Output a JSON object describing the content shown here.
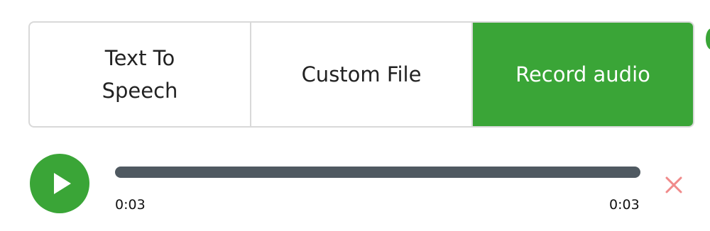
{
  "source_tabs": [
    {
      "label": "Text To Speech",
      "active": false
    },
    {
      "label": "Custom File",
      "active": false
    },
    {
      "label": "Record audio",
      "active": true
    }
  ],
  "player": {
    "current_time": "0:03",
    "duration": "0:03",
    "progress": 1.0
  },
  "colors": {
    "accent": "#3aa537",
    "track": "#4f5961",
    "border": "#d9d9d9",
    "remove": "#f08a8a"
  },
  "icons": {
    "play": "play-icon",
    "remove": "close-icon"
  }
}
